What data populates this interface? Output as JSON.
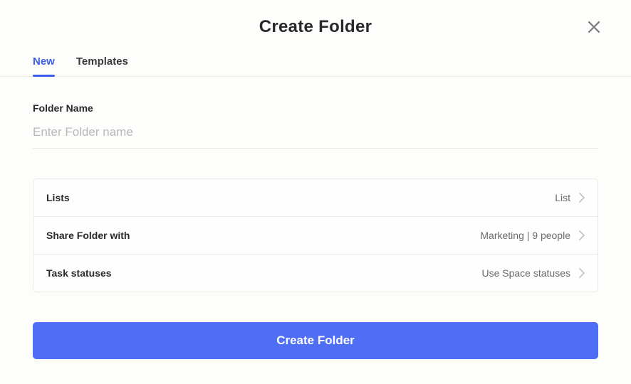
{
  "modal": {
    "title": "Create Folder"
  },
  "tabs": {
    "new": "New",
    "templates": "Templates"
  },
  "folderName": {
    "label": "Folder Name",
    "placeholder": "Enter Folder name",
    "value": ""
  },
  "options": {
    "lists": {
      "label": "Lists",
      "value": "List"
    },
    "share": {
      "label": "Share Folder with",
      "value": "Marketing | 9 people"
    },
    "statuses": {
      "label": "Task statuses",
      "value": "Use Space statuses"
    }
  },
  "actions": {
    "create": "Create Folder"
  }
}
